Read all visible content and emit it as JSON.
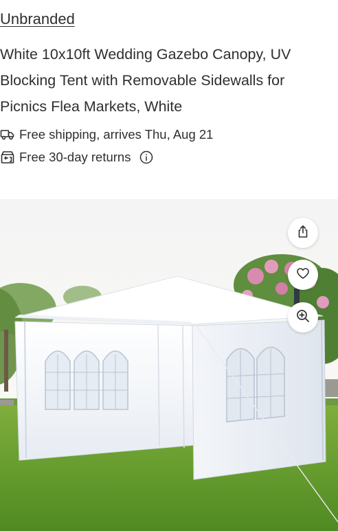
{
  "product": {
    "brand": "Unbranded",
    "title": "White 10x10ft Wedding Gazebo Canopy, UV Blocking Tent with Removable Sidewalls for Picnics Flea Markets, White"
  },
  "fulfillment": {
    "shipping_text": "Free shipping, arrives Thu, Aug 21",
    "shipping_icon": "truck-icon",
    "returns_text": "Free 30-day returns",
    "returns_icon": "returns-icon",
    "returns_info_icon": "info-icon"
  },
  "image_actions": {
    "share_icon": "share-icon",
    "favorite_icon": "heart-icon",
    "zoom_icon": "zoom-in-icon"
  },
  "colors": {
    "text": "#2e2f32",
    "surface": "#ffffff"
  }
}
